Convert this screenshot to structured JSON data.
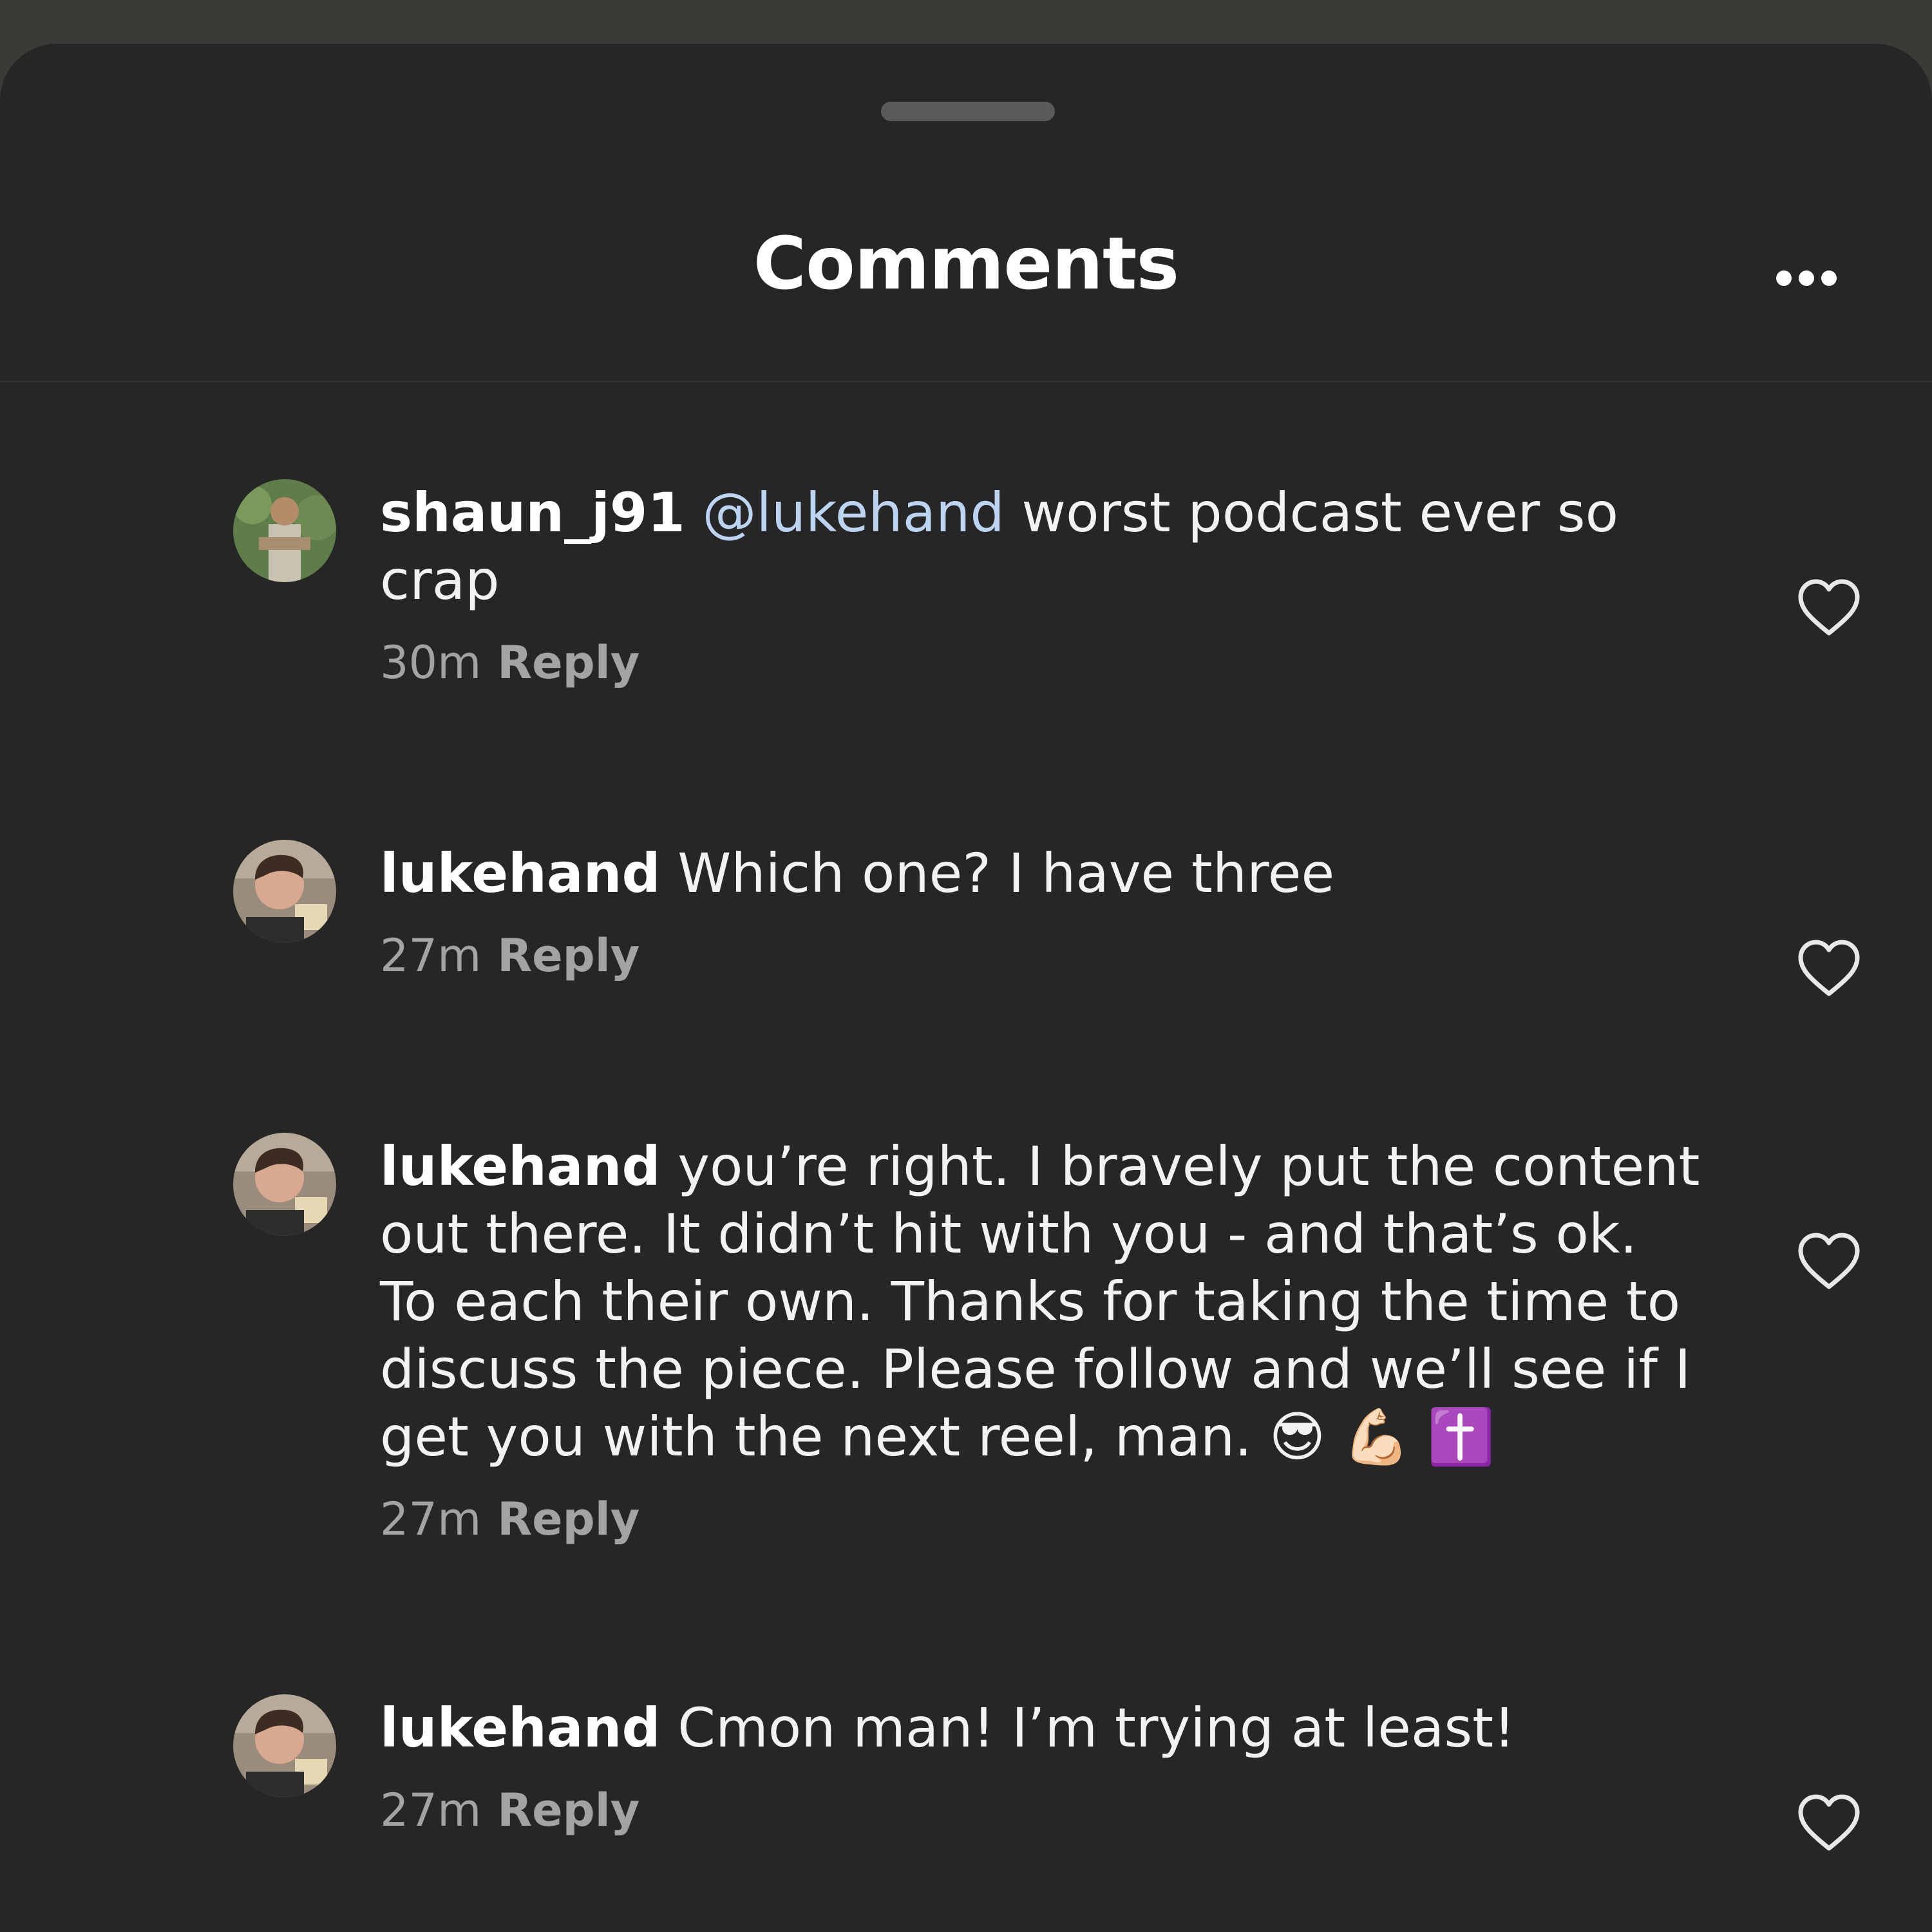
{
  "sheet": {
    "title": "Comments",
    "more_icon": "more-horizontal-icon"
  },
  "colors": {
    "background": "#262626",
    "text": "#f2f2f2",
    "mention": "#bcd4f2",
    "meta": "#a3a3a3"
  },
  "comments": [
    {
      "username": "shaun_j91",
      "mention": "@lukehand",
      "text": "worst podcast ever so crap",
      "time": "30m",
      "reply_label": "Reply"
    },
    {
      "username": "lukehand",
      "text": "Which one? I have three",
      "time": "27m",
      "reply_label": "Reply"
    },
    {
      "username": "lukehand",
      "text": "you’re right. I bravely put the content out there. It didn’t hit with you - and that’s ok. To each their own. Thanks for taking the time to discuss the piece. Please follow and we’ll see if I get you with the next reel, man.",
      "emojis": "😎 💪🏻 ✝️",
      "time": "27m",
      "reply_label": "Reply"
    },
    {
      "username": "lukehand",
      "text": "Cmon man! I’m trying at least!",
      "time": "27m",
      "reply_label": "Reply"
    }
  ]
}
